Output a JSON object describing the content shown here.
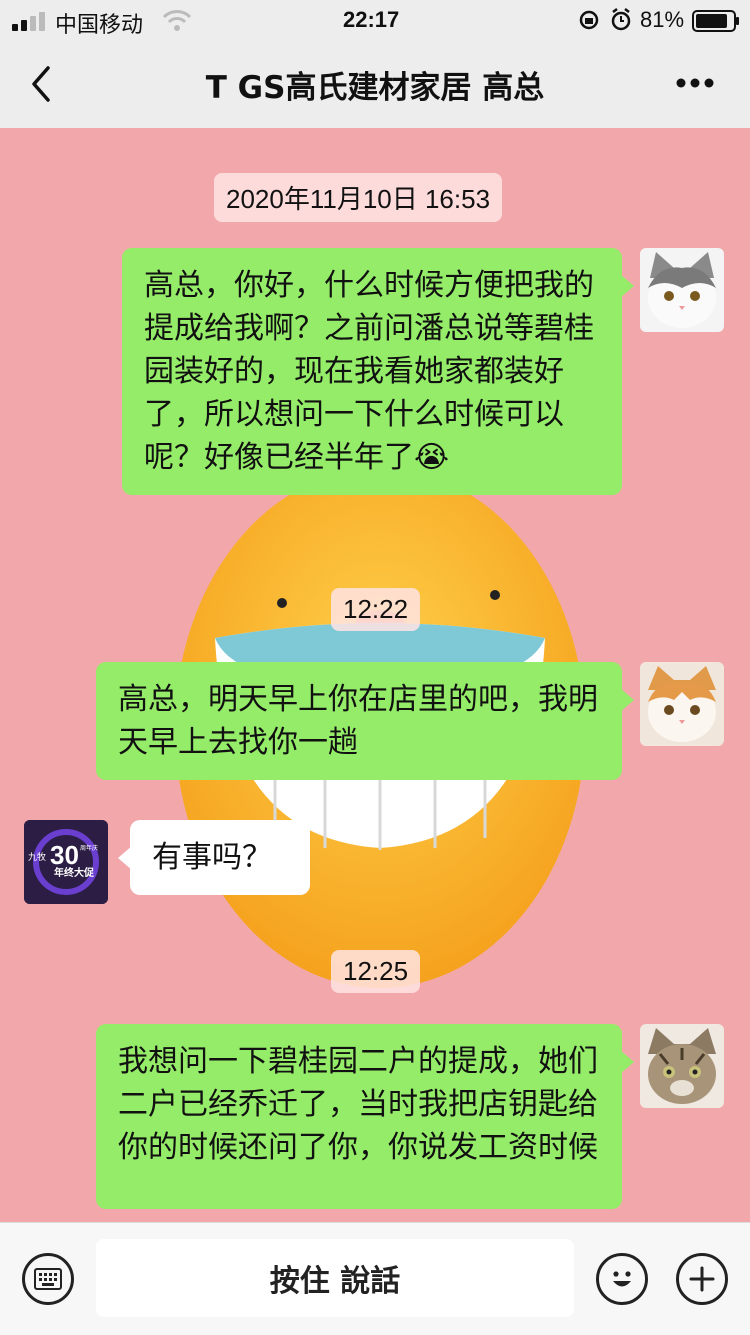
{
  "status_bar": {
    "carrier": "中国移动",
    "time": "22:17",
    "battery": "81%"
  },
  "header": {
    "title": "T GS高氏建材家居 高总"
  },
  "messages": [
    {
      "type": "time",
      "text": "2020年11月10日 16:53"
    },
    {
      "type": "sent",
      "text": "高总，你好，什么时候方便把我的提成给我啊？之前问潘总说等碧桂园装好的，现在我看她家都装好了，所以想问一下什么时候可以呢？好像已经半年了😭"
    },
    {
      "type": "time",
      "text": "12:22"
    },
    {
      "type": "sent",
      "text": "高总，明天早上你在店里的吧，我明天早上去找你一趟"
    },
    {
      "type": "received",
      "text": "有事吗？"
    },
    {
      "type": "time",
      "text": "12:25"
    },
    {
      "type": "sent",
      "text": "我想问一下碧桂园二户的提成，她们二户已经乔迁了，当时我把店钥匙给你的时候还问了你，你说发工资时候"
    }
  ],
  "contact_avatar": {
    "texts": [
      "九牧",
      "30",
      "周年庆",
      "年终大促"
    ]
  },
  "input_bar": {
    "hold_to_talk": "按住 說話"
  },
  "colors": {
    "sent_bubble": "#95ec69",
    "received_bubble": "#ffffff",
    "wallpaper": "#f2a8aa",
    "bar": "#ededed"
  }
}
